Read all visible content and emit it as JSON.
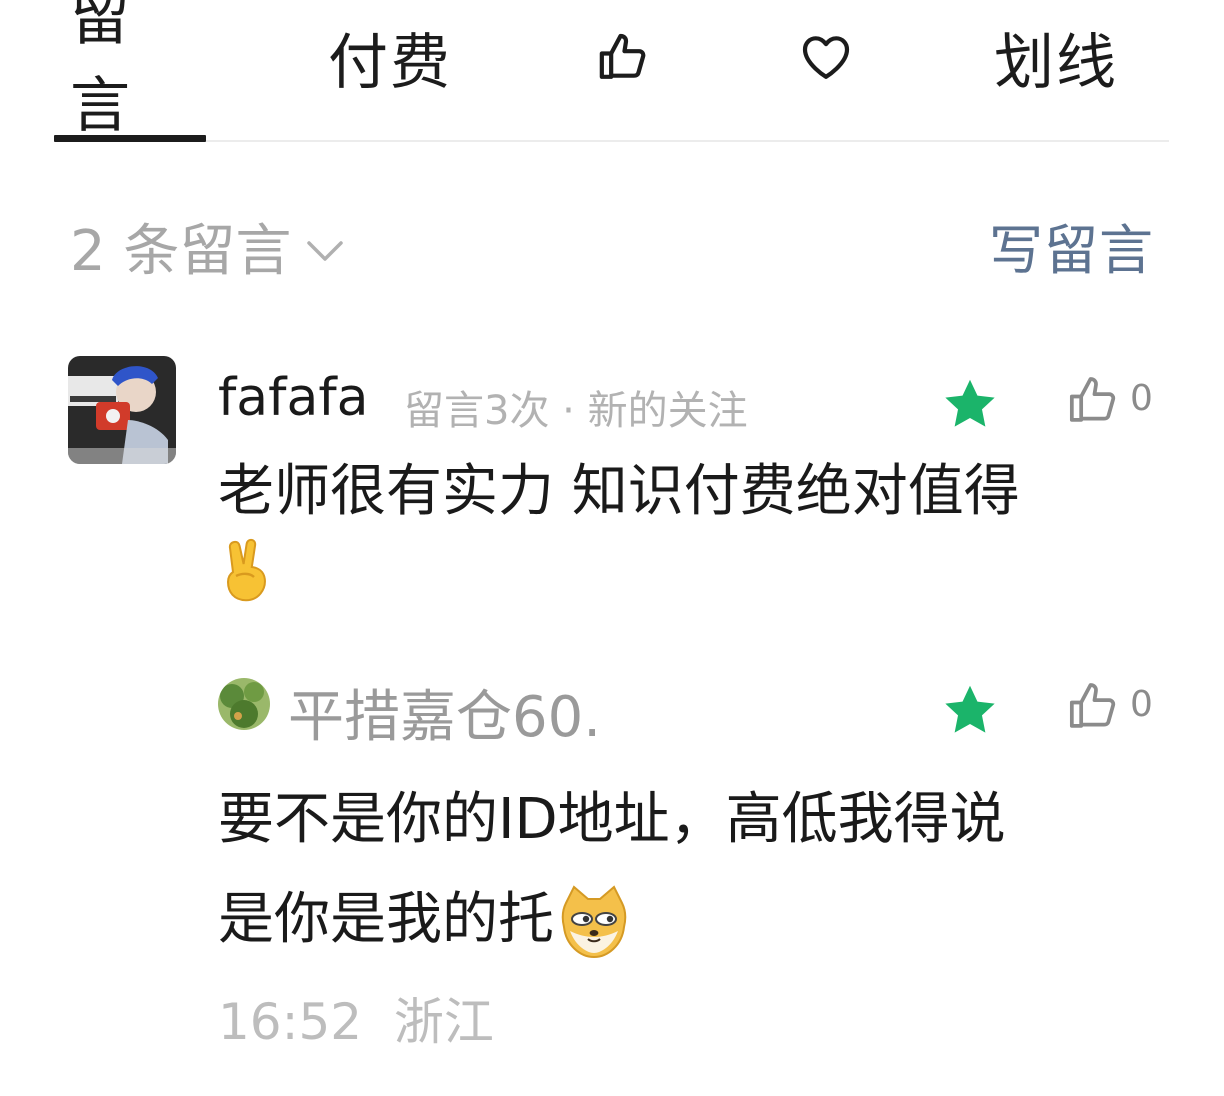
{
  "tabs": [
    {
      "label": "留言",
      "active": true
    },
    {
      "label": "付费"
    },
    {
      "icon": "thumbs-up-icon"
    },
    {
      "icon": "heart-icon"
    },
    {
      "label": "划线"
    }
  ],
  "header": {
    "count_label": "2 条留言",
    "write_label": "写留言"
  },
  "comment": {
    "author": "fafafa",
    "meta": "留言3次 · 新的关注",
    "text": "老师很有实力 知识付费绝对值得",
    "emoji": "victory-hand-emoji",
    "like_count": "0",
    "star_color": "#1bb46a"
  },
  "reply": {
    "author": "平措嘉仓60.",
    "text_line1": "要不是你的ID地址，高低我得说",
    "text_line2": "是你是我的托",
    "emoji": "doge-emoji",
    "like_count": "0",
    "time": "16:52",
    "location": "浙江"
  }
}
